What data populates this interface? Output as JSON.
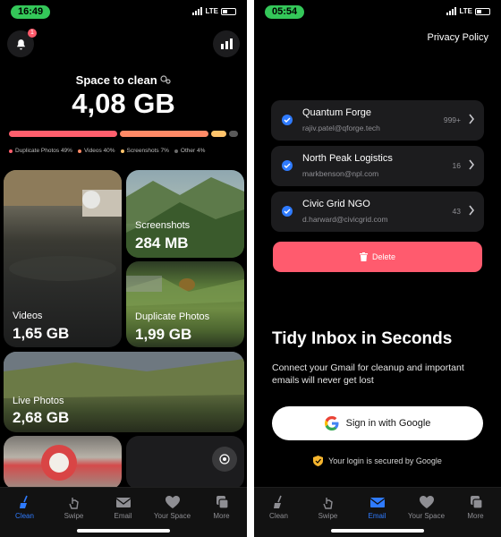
{
  "left_screen": {
    "status": {
      "time": "16:49",
      "network": "LTE"
    },
    "notification_badge": "1",
    "space_label": "Space to clean",
    "space_value": "4,08 GB",
    "storage_bar": [
      {
        "name": "Duplicate Photos",
        "fraction": 0.49,
        "color": "#ff5f6d"
      },
      {
        "name": "Videos",
        "fraction": 0.4,
        "color": "#ff8a66"
      },
      {
        "name": "Screenshots",
        "fraction": 0.07,
        "color": "#ffc46b"
      },
      {
        "name": "Other",
        "fraction": 0.04,
        "color": "#5a5a5a"
      }
    ],
    "legend": [
      {
        "label": "Duplicate Photos 49%",
        "color": "#ff5f6d"
      },
      {
        "label": "Videos 40%",
        "color": "#ff8a66"
      },
      {
        "label": "Screenshots 7%",
        "color": "#ffc46b"
      },
      {
        "label": "Other 4%",
        "color": "#6a6a6a"
      }
    ],
    "tiles": {
      "videos": {
        "title": "Videos",
        "size": "1,65 GB"
      },
      "screenshots": {
        "title": "Screenshots",
        "size": "284 MB"
      },
      "duplicates": {
        "title": "Duplicate Photos",
        "size": "1,99 GB"
      },
      "live": {
        "title": "Live Photos",
        "size": "2,68 GB"
      }
    },
    "tabs": [
      {
        "label": "Clean",
        "icon": "broom-icon",
        "active": true
      },
      {
        "label": "Swipe",
        "icon": "hand-swipe-icon",
        "active": false
      },
      {
        "label": "Email",
        "icon": "envelope-icon",
        "active": false
      },
      {
        "label": "Your Space",
        "icon": "heart-icon",
        "active": false
      },
      {
        "label": "More",
        "icon": "more-squares-icon",
        "active": false
      }
    ]
  },
  "right_screen": {
    "status": {
      "time": "05:54",
      "network": "LTE"
    },
    "privacy_link": "Privacy Policy",
    "accounts": [
      {
        "name": "Quantum Forge",
        "email": "rajiv.patel@qforge.tech",
        "count": "999+"
      },
      {
        "name": "North Peak Logistics",
        "email": "markbenson@npl.com",
        "count": "16"
      },
      {
        "name": "Civic Grid NGO",
        "email": "d.harward@civicgrid.com",
        "count": "43"
      }
    ],
    "delete_label": "Delete",
    "headline": "Tidy Inbox in Seconds",
    "subtext": "Connect your Gmail for cleanup and important emails will never get lost",
    "google_button": "Sign in with Google",
    "secured_text": "Your login is secured by Google",
    "tabs": [
      {
        "label": "Clean",
        "icon": "broom-icon",
        "active": false
      },
      {
        "label": "Swipe",
        "icon": "hand-swipe-icon",
        "active": false
      },
      {
        "label": "Email",
        "icon": "envelope-icon",
        "active": true
      },
      {
        "label": "Your Space",
        "icon": "heart-icon",
        "active": false
      },
      {
        "label": "More",
        "icon": "more-squares-icon",
        "active": false
      }
    ]
  },
  "colors": {
    "accent_blue": "#2f7bff",
    "delete_red": "#ff5b6e",
    "status_green": "#34c759",
    "shield_gold": "#f5b52e"
  }
}
